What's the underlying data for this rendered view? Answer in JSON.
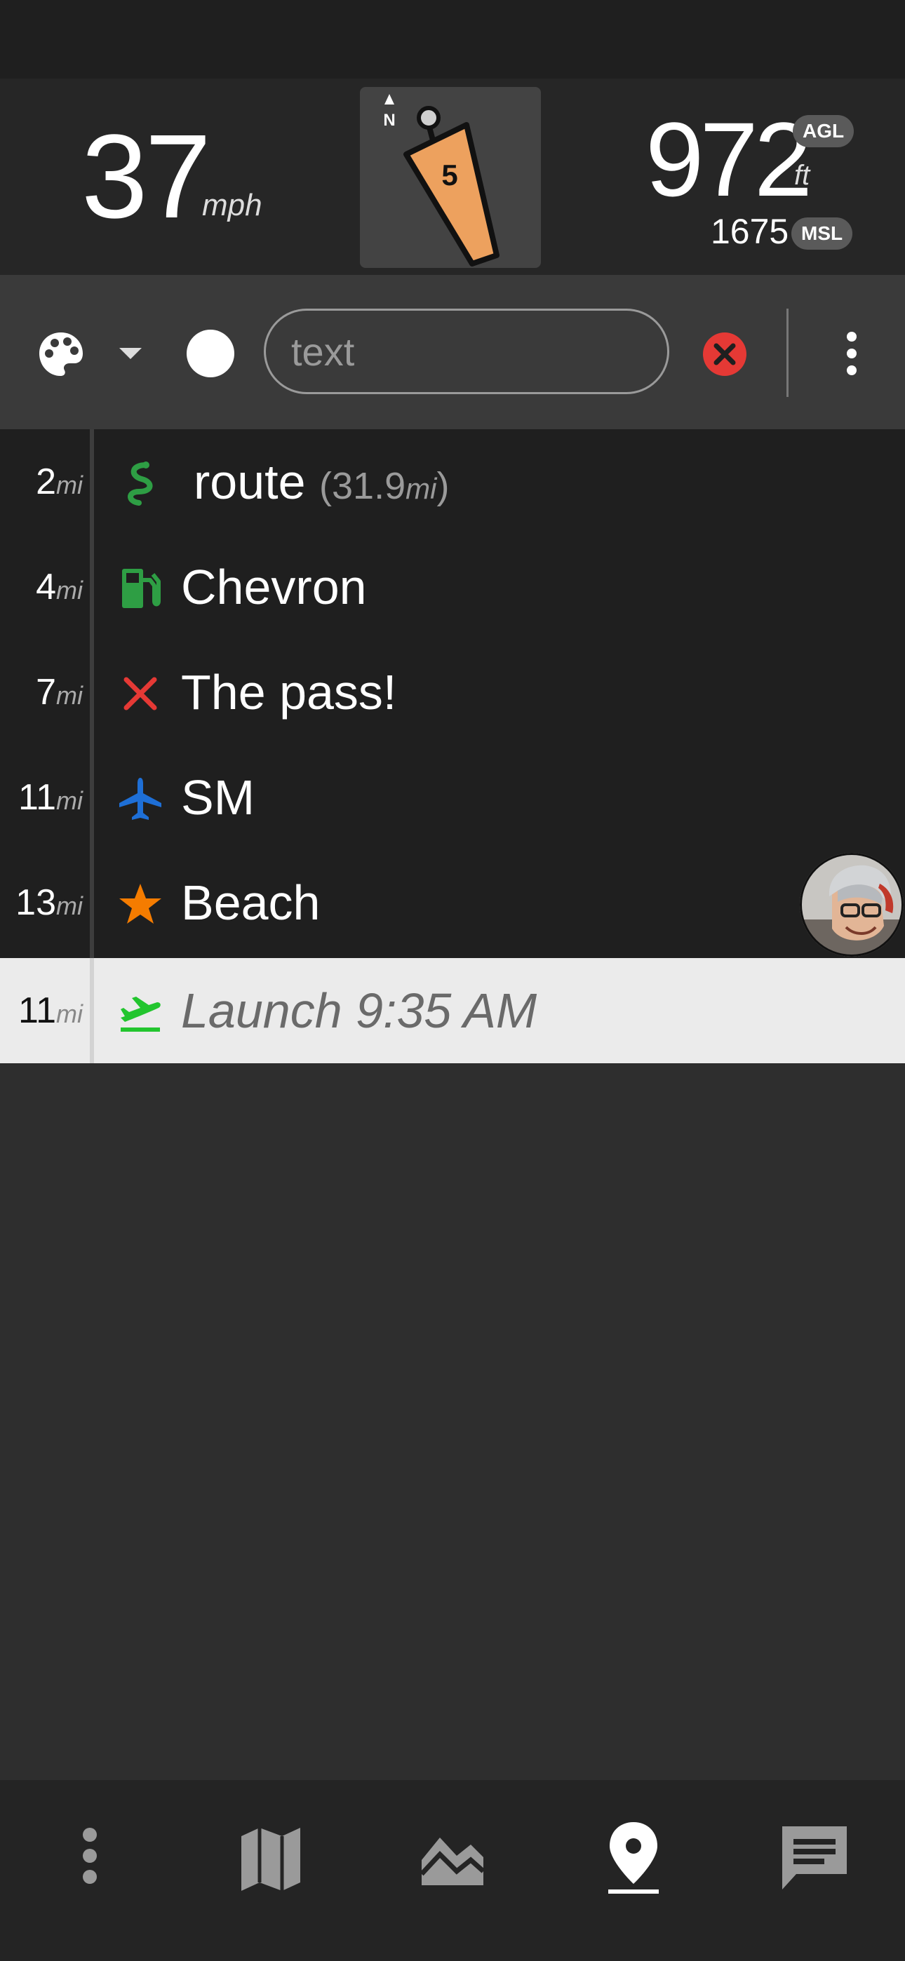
{
  "telemetry": {
    "speed": "37",
    "speed_unit": "mph",
    "wind": {
      "north_label": "N",
      "speed": "5"
    },
    "altitude": "972",
    "altitude_unit": "ft",
    "agl_label": "AGL",
    "msl_altitude": "1675",
    "msl_label": "MSL"
  },
  "toolbar": {
    "text_placeholder": "text",
    "icons": [
      "palette-icon",
      "dropdown-arrow-icon",
      "color-swatch-icon",
      "clear-icon",
      "more-vert-icon"
    ],
    "swatch_color": "#ffffff",
    "clear_color": "#e53935"
  },
  "waypoints": [
    {
      "dist": "2",
      "unit": "mi",
      "icon": "route-icon",
      "label": "route",
      "sub_value": "(31.9",
      "sub_unit": "mi",
      "sub_close": ")"
    },
    {
      "dist": "4",
      "unit": "mi",
      "icon": "fuel-icon",
      "label": "Chevron"
    },
    {
      "dist": "7",
      "unit": "mi",
      "icon": "cross-icon",
      "label": "The pass!"
    },
    {
      "dist": "11",
      "unit": "mi",
      "icon": "airplane-icon",
      "label": "SM"
    },
    {
      "dist": "13",
      "unit": "mi",
      "icon": "star-icon",
      "label": "Beach"
    }
  ],
  "launch": {
    "dist": "11",
    "unit": "mi",
    "icon": "takeoff-icon",
    "label": "Launch 9:35 AM"
  },
  "colors": {
    "route": "#2e9e44",
    "fuel": "#2e9e44",
    "cross": "#e53935",
    "airplane": "#1e6fd6",
    "star": "#f57c00",
    "takeoff": "#22c52e",
    "wind_cone": "#eda15e"
  },
  "nav": {
    "items": [
      "more-vert-icon",
      "map-icon",
      "elevation-chart-icon",
      "waypoint-icon",
      "chat-icon"
    ],
    "active": "waypoint-icon"
  }
}
